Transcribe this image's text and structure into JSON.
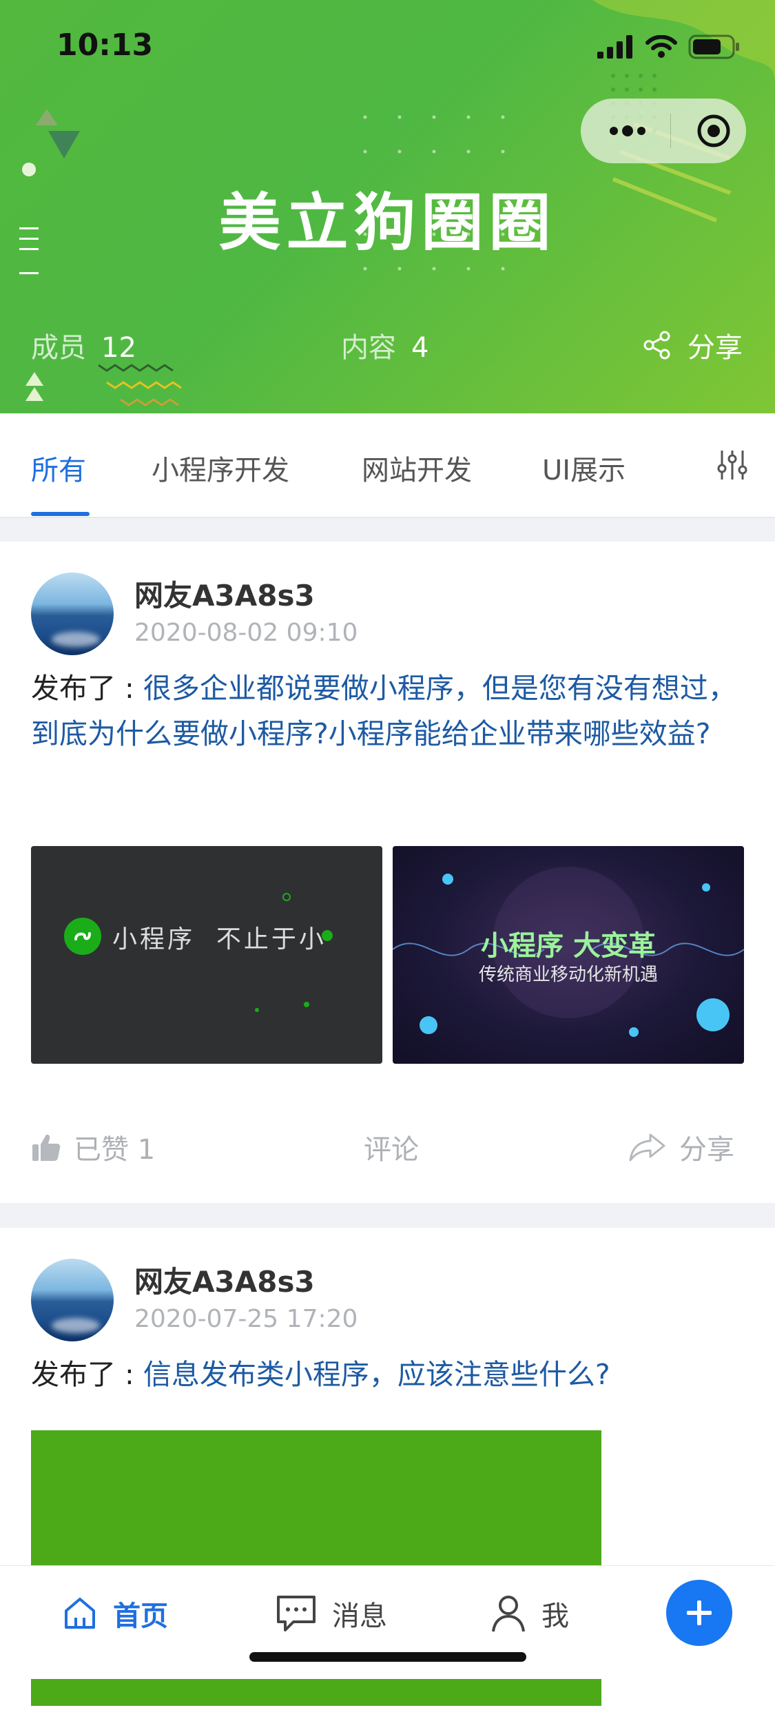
{
  "status_bar": {
    "time": "10:13"
  },
  "header": {
    "brand_title": "美立狗圈圈",
    "members_label": "成员",
    "members_count": "12",
    "content_label": "内容",
    "content_count": "4",
    "share_label": "分享"
  },
  "tabs": {
    "items": [
      "所有",
      "小程序开发",
      "网站开发",
      "UI展示"
    ],
    "active": "所有"
  },
  "posts": [
    {
      "username": "网友A3A8s3",
      "datetime": "2020-08-02 09:10",
      "prefix": "发布了 : ",
      "title": "很多企业都说要做小程序，但是您有没有想过，到底为什么要做小程序?小程序能给企业带来哪些效益?",
      "images": [
        {
          "caption": "小程序  不止于小"
        },
        {
          "caption_main": "小程序 大变革",
          "caption_sub": "传统商业移动化新机遇"
        }
      ],
      "actions": {
        "like_label": "已赞 1",
        "comment_label": "评论",
        "share_label": "分享"
      }
    },
    {
      "username": "网友A3A8s3",
      "datetime": "2020-07-25 17:20",
      "prefix": "发布了 : ",
      "title": "信息发布类小程序，应该注意些什么?"
    }
  ],
  "bottom_nav": {
    "home_label": "首页",
    "messages_label": "消息",
    "me_label": "我"
  },
  "colors": {
    "accent": "#1f6fe0",
    "header_green": "#52b83e",
    "link_blue": "#1d5aa3"
  }
}
